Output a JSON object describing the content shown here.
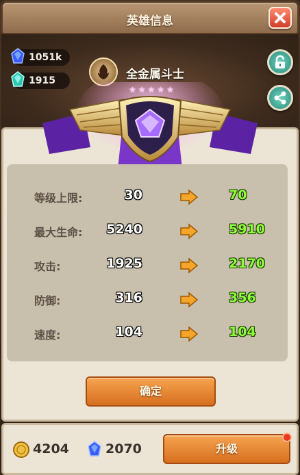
{
  "window": {
    "title": "英雄信息"
  },
  "resources_top": [
    {
      "icon": "blue-crystal-icon",
      "value": "1051k"
    },
    {
      "icon": "teal-crystal-icon",
      "value": "1915"
    }
  ],
  "hero": {
    "name": "全金属斗士",
    "star_count": 5,
    "emblem_icon": "rebel-emblem-icon"
  },
  "side_buttons": [
    "unlock-icon",
    "share-icon"
  ],
  "stats": [
    {
      "label": "等级上限:",
      "old": "30",
      "new": "70"
    },
    {
      "label": "最大生命:",
      "old": "5240",
      "new": "5910"
    },
    {
      "label": "攻击:",
      "old": "1925",
      "new": "2170"
    },
    {
      "label": "防御:",
      "old": "316",
      "new": "356"
    },
    {
      "label": "速度:",
      "old": "104",
      "new": "104"
    }
  ],
  "confirm_label": "确定",
  "bottom": {
    "gold": "4204",
    "crystal": "2070",
    "upgrade_label": "升级"
  },
  "colors": {
    "accent_orange": "#e4843a",
    "new_value_green": "#8dfc3c",
    "crest_purple": "#7a35c9",
    "close_red": "#d23d28"
  }
}
